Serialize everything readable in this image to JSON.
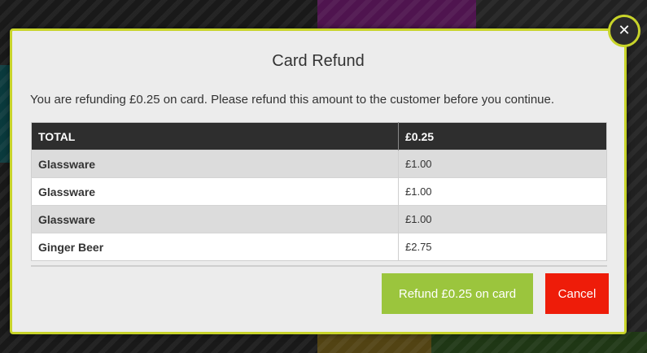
{
  "modal": {
    "title": "Card Refund",
    "message": "You are refunding £0.25 on card. Please refund this amount to the customer before you continue.",
    "close_icon": "close-icon",
    "table": {
      "header": {
        "label": "TOTAL",
        "amount": "£0.25"
      },
      "rows": [
        {
          "item": "Glassware",
          "price": "£1.00"
        },
        {
          "item": "Glassware",
          "price": "£1.00"
        },
        {
          "item": "Glassware",
          "price": "£1.00"
        },
        {
          "item": "Ginger Beer",
          "price": "£2.75"
        }
      ]
    },
    "buttons": {
      "refund_label": "Refund £0.25 on card",
      "cancel_label": "Cancel"
    }
  },
  "colors": {
    "accent_border": "#c8d42a",
    "refund_button": "#9bc53d",
    "cancel_button": "#ee1c09",
    "table_header": "#2e2e2e"
  }
}
